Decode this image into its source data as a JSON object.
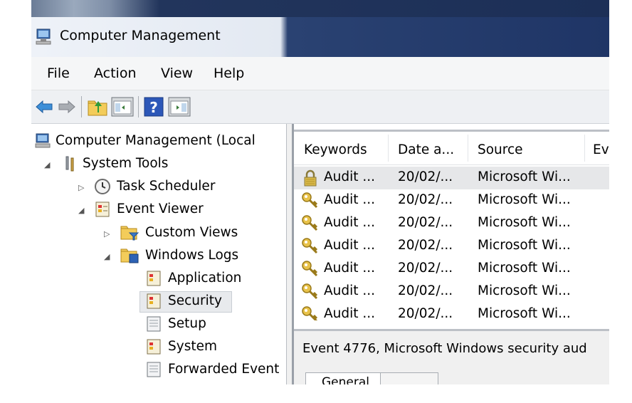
{
  "window": {
    "title": "Computer Management"
  },
  "menu": [
    "File",
    "Action",
    "View",
    "Help"
  ],
  "toolbar": {
    "icons": [
      "back-arrow-icon",
      "forward-arrow-icon",
      "up-folder-icon",
      "show-hide-console-tree-icon",
      "help-icon",
      "show-hide-action-pane-icon"
    ]
  },
  "tree": {
    "root": "Computer Management (Local",
    "system_tools": "System Tools",
    "task_scheduler": "Task Scheduler",
    "event_viewer": "Event Viewer",
    "custom_views": "Custom Views",
    "windows_logs": "Windows Logs",
    "application": "Application",
    "security": "Security",
    "setup": "Setup",
    "system": "System",
    "forwarded": "Forwarded Event"
  },
  "list": {
    "columns": [
      "Keywords",
      "Date a...",
      "Source",
      "Ev"
    ],
    "rows": [
      {
        "keywords": "Audit ...",
        "date": "20/02/...",
        "source": "Microsoft Wi...",
        "icon": "audit-failure-lock-icon"
      },
      {
        "keywords": "Audit ...",
        "date": "20/02/...",
        "source": "Microsoft Wi...",
        "icon": "audit-success-key-icon"
      },
      {
        "keywords": "Audit ...",
        "date": "20/02/...",
        "source": "Microsoft Wi...",
        "icon": "audit-success-key-icon"
      },
      {
        "keywords": "Audit ...",
        "date": "20/02/...",
        "source": "Microsoft Wi...",
        "icon": "audit-success-key-icon"
      },
      {
        "keywords": "Audit ...",
        "date": "20/02/...",
        "source": "Microsoft Wi...",
        "icon": "audit-success-key-icon"
      },
      {
        "keywords": "Audit ...",
        "date": "20/02/...",
        "source": "Microsoft Wi...",
        "icon": "audit-success-key-icon"
      },
      {
        "keywords": "Audit ...",
        "date": "20/02/...",
        "source": "Microsoft Wi...",
        "icon": "audit-success-key-icon"
      }
    ]
  },
  "detail": {
    "title": "Event 4776, Microsoft Windows security aud",
    "tabs": [
      "General",
      ""
    ]
  }
}
